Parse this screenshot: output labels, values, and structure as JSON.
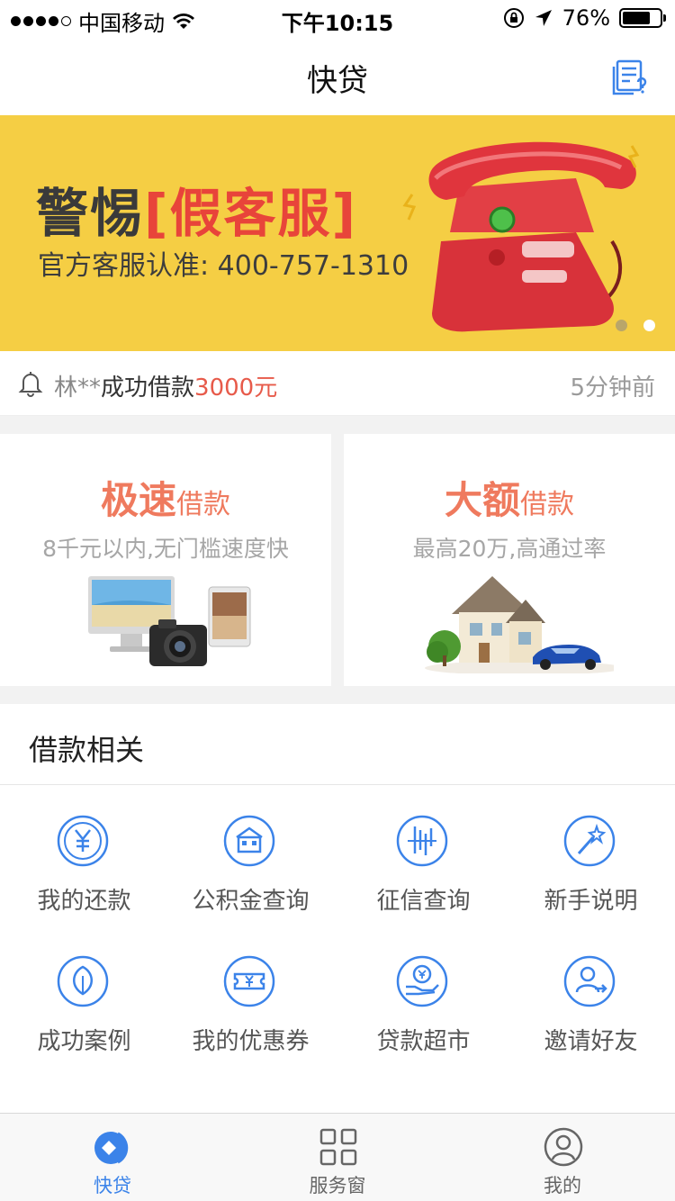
{
  "status_bar": {
    "carrier": "中国移动",
    "time": "下午10:15",
    "battery": "76%",
    "battery_level": 0.76
  },
  "nav": {
    "title": "快贷",
    "help_icon": "document-question-icon"
  },
  "banner": {
    "headline_prefix": "警惕",
    "headline_highlight": "[假客服]",
    "subtitle": "官方客服认准: 400-757-1310",
    "slides": 2,
    "active_slide": 2
  },
  "notice": {
    "name": "林**",
    "action": "成功借款",
    "amount": "3000元",
    "time": "5分钟前"
  },
  "products": [
    {
      "big": "极速",
      "small": "借款",
      "desc": "8千元以内,无门槛速度快"
    },
    {
      "big": "大额",
      "small": "借款",
      "desc": "最高20万,高通过率"
    }
  ],
  "loan_section": {
    "title": "借款相关",
    "items": [
      {
        "label": "我的还款",
        "icon": "yuan-coin-icon"
      },
      {
        "label": "公积金查询",
        "icon": "building-icon"
      },
      {
        "label": "征信查询",
        "icon": "credit-report-icon"
      },
      {
        "label": "新手说明",
        "icon": "magic-wand-icon"
      },
      {
        "label": "成功案例",
        "icon": "leaf-icon"
      },
      {
        "label": "我的优惠券",
        "icon": "coupon-icon"
      },
      {
        "label": "贷款超市",
        "icon": "hand-coin-icon"
      },
      {
        "label": "邀请好友",
        "icon": "invite-user-icon"
      }
    ]
  },
  "tabbar": {
    "tabs": [
      {
        "label": "快贷",
        "icon": "quick-loan-icon",
        "active": true
      },
      {
        "label": "服务窗",
        "icon": "grid-icon",
        "active": false
      },
      {
        "label": "我的",
        "icon": "user-icon",
        "active": false
      }
    ]
  },
  "colors": {
    "accent_blue": "#3b83e9",
    "banner_yellow": "#f5ce44",
    "product_orange": "#ef7a5e",
    "amount_red": "#e75a4a"
  }
}
